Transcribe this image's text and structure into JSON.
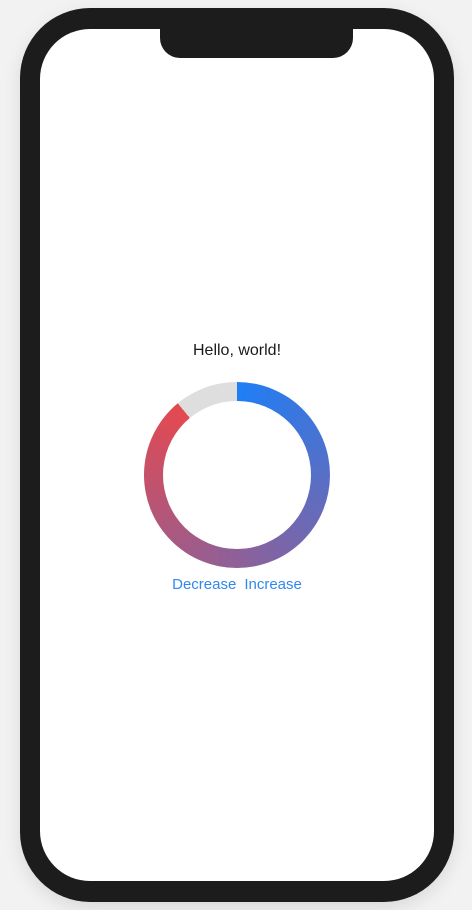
{
  "greeting": "Hello, world!",
  "progress": {
    "value_fraction": 0.89,
    "track_color": "#dedede",
    "gradient_start_color": "#1f7ef5",
    "gradient_end_color": "#e44950"
  },
  "buttons": {
    "decrease_label": "Decrease",
    "increase_label": "Increase"
  }
}
